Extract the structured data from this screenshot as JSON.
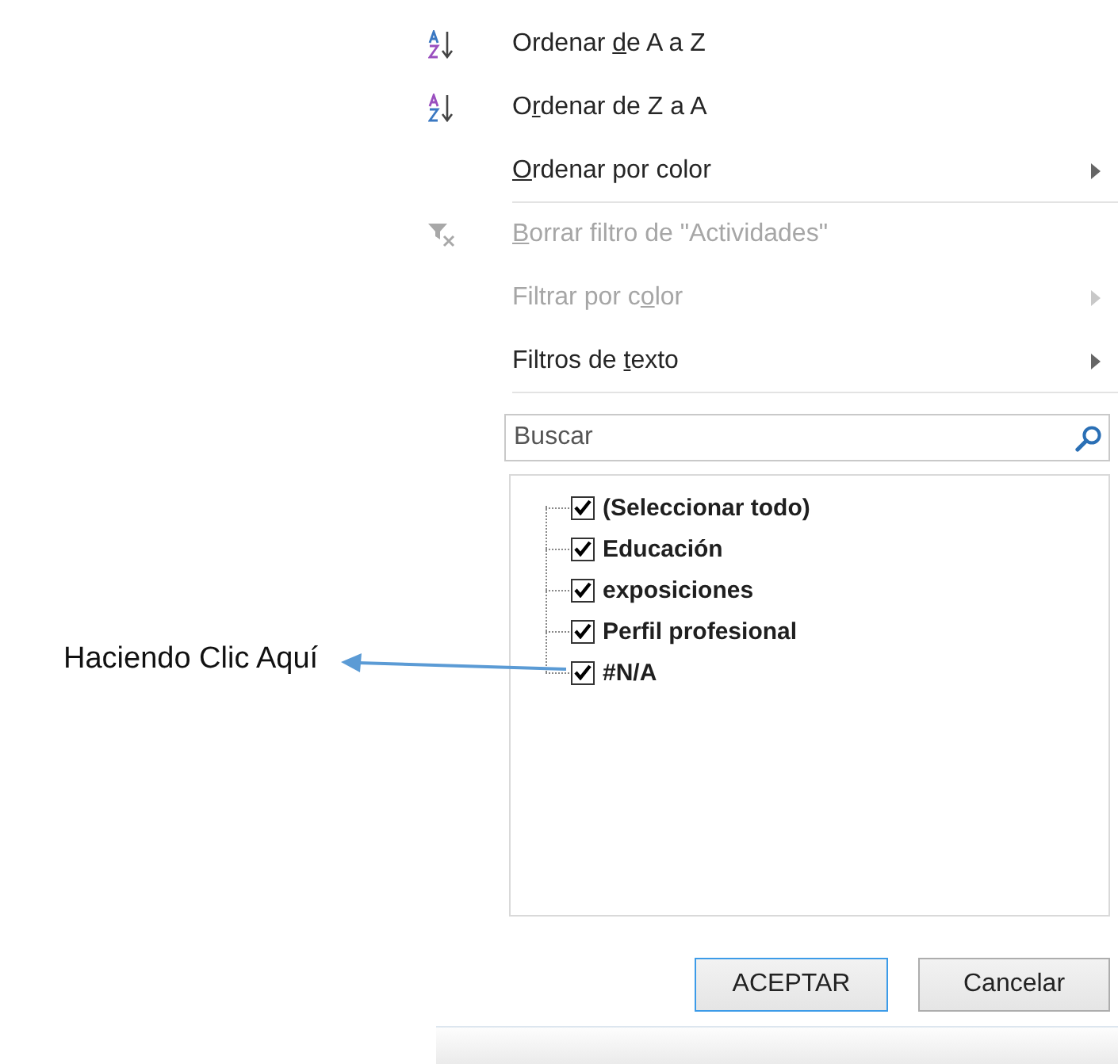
{
  "menu": [
    {
      "kind": "sort-az",
      "before": "Ordenar ",
      "key": "d",
      "after": "e A a Z",
      "disabled": false,
      "submenu": false
    },
    {
      "kind": "sort-za",
      "before": "O",
      "key": "r",
      "after": "denar de Z a A",
      "disabled": false,
      "submenu": false
    },
    {
      "kind": "plain",
      "key": "O",
      "after": "rdenar por color",
      "disabled": false,
      "submenu": true
    },
    {
      "kind": "separator"
    },
    {
      "kind": "clear-filter",
      "key": "B",
      "after": "orrar filtro de \"Actividades\"",
      "disabled": true,
      "submenu": false
    },
    {
      "kind": "plain",
      "before": "Filtrar por c",
      "key": "o",
      "after": "lor",
      "disabled": true,
      "submenu": true
    },
    {
      "kind": "plain",
      "before": "Filtros de ",
      "key": "t",
      "after": "exto",
      "disabled": false,
      "submenu": true
    },
    {
      "kind": "separator"
    }
  ],
  "search": {
    "placeholder": "Buscar"
  },
  "values": [
    {
      "label": "(Seleccionar todo)",
      "checked": true
    },
    {
      "label": "Educación",
      "checked": true
    },
    {
      "label": "exposiciones",
      "checked": true
    },
    {
      "label": "Perfil profesional",
      "checked": true
    },
    {
      "label": "#N/A",
      "checked": true
    }
  ],
  "buttons": [
    {
      "label": "ACEPTAR",
      "default": true
    },
    {
      "label": "Cancelar",
      "default": false
    }
  ],
  "annotation": {
    "text": "Haciendo Clic Aquí"
  }
}
